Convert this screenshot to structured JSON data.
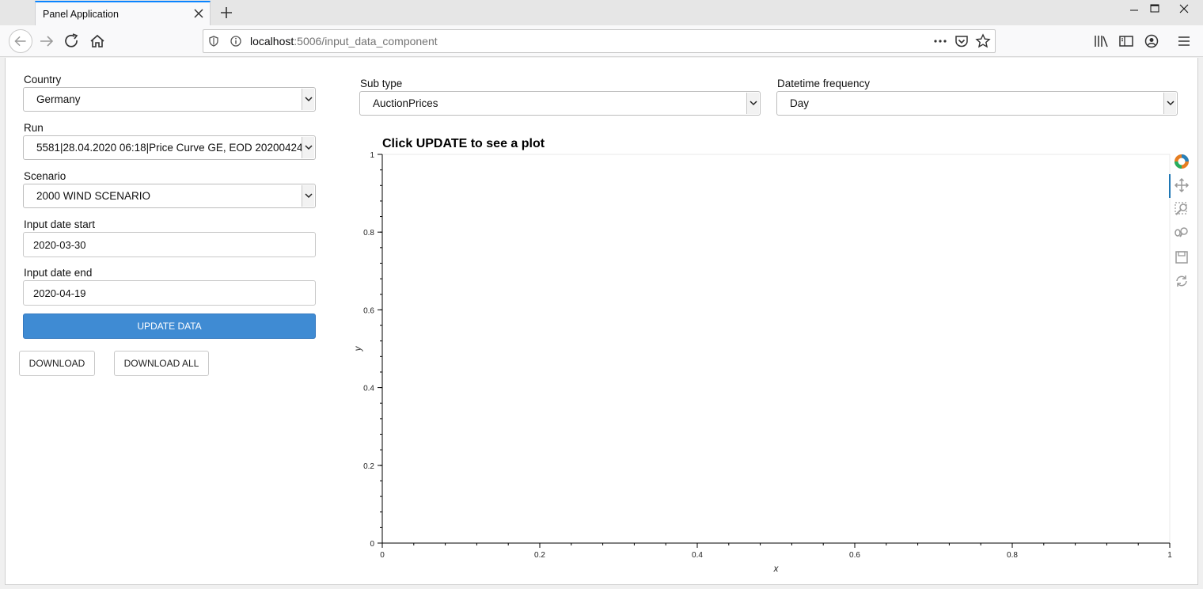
{
  "browser": {
    "tab_title": "Panel Application",
    "url_host": "localhost",
    "url_rest": ":5006/input_data_component"
  },
  "sidebar": {
    "country": {
      "label": "Country",
      "value": "Germany"
    },
    "run": {
      "label": "Run",
      "value": "5581|28.04.2020 06:18|Price Curve GE, EOD 20200424"
    },
    "scenario": {
      "label": "Scenario",
      "value": "2000 WIND SCENARIO"
    },
    "date_start": {
      "label": "Input date start",
      "value": "2020-03-30"
    },
    "date_end": {
      "label": "Input date end",
      "value": "2020-04-19"
    },
    "update_label": "UPDATE DATA",
    "download_label": "DOWNLOAD",
    "download_all_label": "DOWNLOAD ALL"
  },
  "main": {
    "subtype": {
      "label": "Sub type",
      "value": "AuctionPrices"
    },
    "frequency": {
      "label": "Datetime frequency",
      "value": "Day"
    }
  },
  "chart_data": {
    "type": "line",
    "title": "Click UPDATE to see a plot",
    "xlabel": "x",
    "ylabel": "y",
    "xlim": [
      0,
      1
    ],
    "ylim": [
      0,
      1
    ],
    "xticks": [
      "0",
      "0.2",
      "0.4",
      "0.6",
      "0.8",
      "1"
    ],
    "yticks": [
      "0",
      "0.2",
      "0.4",
      "0.6",
      "0.8",
      "1"
    ],
    "series": [],
    "grid": false
  },
  "plot_toolbar": [
    "bokeh-logo-icon",
    "pan-icon",
    "box-zoom-icon",
    "wheel-zoom-icon",
    "save-icon",
    "reset-icon"
  ]
}
